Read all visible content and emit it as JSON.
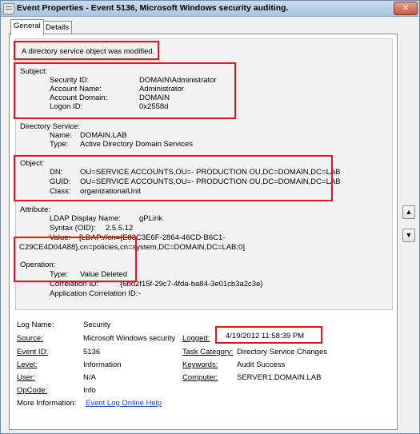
{
  "window": {
    "title": "Event Properties - Event 5136, Microsoft Windows security auditing.",
    "close_label": "✕"
  },
  "tabs": [
    {
      "label": "General"
    },
    {
      "label": "Details"
    }
  ],
  "description": {
    "headline": "A directory service object was modified.",
    "subject": {
      "heading": "Subject:",
      "rows": [
        {
          "label": "Security ID:",
          "value": "DOMAIN\\Administrator"
        },
        {
          "label": "Account Name:",
          "value": "Administrator"
        },
        {
          "label": "Account Domain:",
          "value": "DOMAIN"
        },
        {
          "label": "Logon ID:",
          "value": "0x2558d"
        }
      ]
    },
    "directory_service": {
      "heading": "Directory Service:",
      "rows": [
        {
          "label": "Name:",
          "value": "DOMAIN.LAB"
        },
        {
          "label": "Type:",
          "value": "Active Directory Domain Services"
        }
      ]
    },
    "object": {
      "heading": "Object:",
      "rows": [
        {
          "label": "DN:",
          "value": "OU=SERVICE ACCOUNTS,OU=- PRODUCTION OU,DC=DOMAIN,DC=LAB"
        },
        {
          "label": "GUID:",
          "value": "OU=SERVICE ACCOUNTS,OU=- PRODUCTION OU,DC=DOMAIN,DC=LAB"
        },
        {
          "label": "Class:",
          "value": "organizationalUnit"
        }
      ]
    },
    "attribute": {
      "heading": "Attribute:",
      "rows": [
        {
          "label": "LDAP Display Name:",
          "value": "gPLink"
        },
        {
          "label": "Syntax (OID):",
          "value": "2.5.5.12"
        },
        {
          "label": "Value:",
          "value": "[LDAP://cn={E83C3E6F-2864-46CD-B6C1-"
        }
      ],
      "value_continued": "C29CE4D04A88},cn=policies,cn=system,DC=DOMAIN,DC=LAB;0]"
    },
    "operation": {
      "heading": "Operation:",
      "rows": [
        {
          "label": "Type:",
          "value": "Value Deleted"
        },
        {
          "label": "Correlation ID:",
          "value": "{6bd2f15f-29c7-4fda-ba84-3e01cb3a2c3e}"
        },
        {
          "label": "Application Correlation ID:",
          "value": "-"
        }
      ]
    }
  },
  "fields": {
    "log_name": {
      "label": "Log Name:",
      "value": "Security"
    },
    "source": {
      "label": "Source:",
      "value": "Microsoft Windows security"
    },
    "logged": {
      "label": "Logged:",
      "value": "4/19/2012 11:58:39 PM"
    },
    "event_id": {
      "label": "Event ID:",
      "value": "5136"
    },
    "task_category": {
      "label": "Task Category:",
      "value": "Directory Service Changes"
    },
    "level": {
      "label": "Level:",
      "value": "Information"
    },
    "keywords": {
      "label": "Keywords:",
      "value": "Audit Success"
    },
    "user": {
      "label": "User:",
      "value": "N/A"
    },
    "computer": {
      "label": "Computer:",
      "value": "SERVER1.DOMAIN.LAB"
    },
    "opcode": {
      "label": "OpCode:",
      "value": "Info"
    },
    "more_info": {
      "label": "More Information:",
      "link": "Event Log Online Help"
    }
  },
  "side_buttons": [
    {
      "icon": "arrow-up-icon",
      "glyph": "▲"
    },
    {
      "icon": "arrow-down-icon",
      "glyph": "▼"
    }
  ],
  "colors": {
    "highlight": "#e8141e",
    "link": "#1a44c7"
  }
}
